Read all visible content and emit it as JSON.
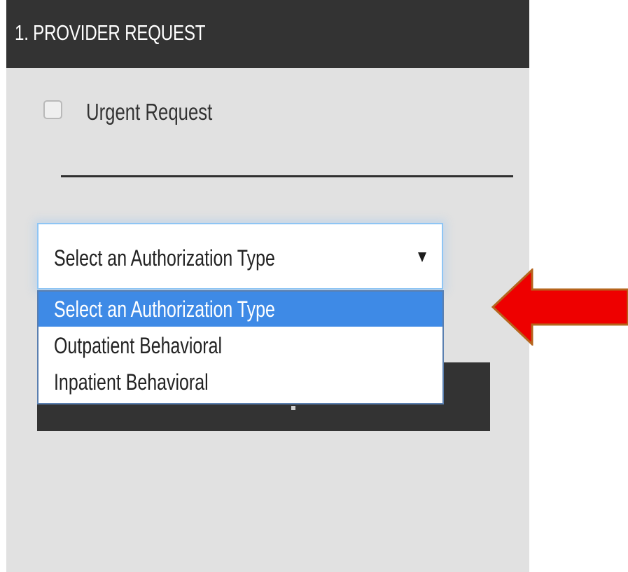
{
  "panel": {
    "title": "1. PROVIDER REQUEST"
  },
  "urgent": {
    "label": "Urgent Request",
    "checked": false
  },
  "authorization_select": {
    "value": "Select an Authorization Type",
    "options": [
      "Select an Authorization Type",
      "Outpatient Behavioral",
      "Inpatient Behavioral"
    ],
    "highlighted_index": 0
  },
  "colors": {
    "header_bg": "#333333",
    "panel_bg": "#e1e1e1",
    "highlight": "#3e8ae6",
    "annotation_arrow": "#ee0000"
  },
  "icons": {
    "dropdown": "triangle-down",
    "annotation": "arrow-left"
  }
}
